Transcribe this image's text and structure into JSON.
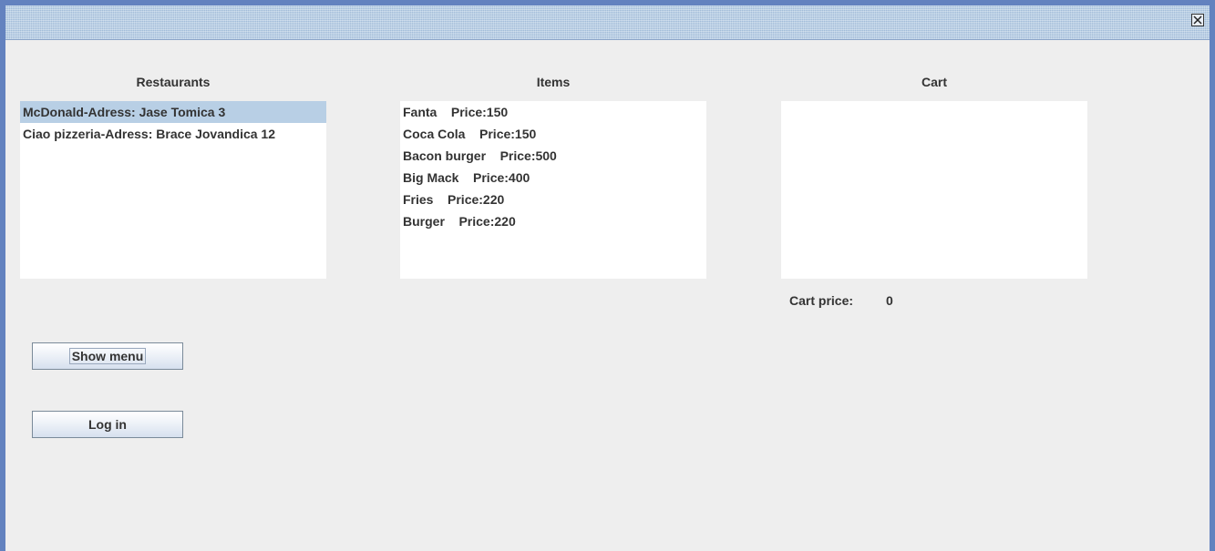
{
  "window": {
    "close_icon": "close-icon"
  },
  "restaurants": {
    "label": "Restaurants",
    "items": [
      {
        "text": "McDonald-Adress: Jase Tomica 3",
        "selected": true
      },
      {
        "text": "Ciao pizzeria-Adress: Brace Jovandica 12",
        "selected": false
      }
    ]
  },
  "items": {
    "label": "Items",
    "rows": [
      "Fanta    Price:150",
      "Coca Cola    Price:150",
      "Bacon burger    Price:500",
      "Big Mack    Price:400",
      "Fries    Price:220",
      "Burger    Price:220"
    ]
  },
  "cart": {
    "label": "Cart",
    "rows": [],
    "price_label": "Cart price:",
    "price_value": "0"
  },
  "buttons": {
    "show_menu": "Show menu",
    "log_in": "Log in"
  },
  "colors": {
    "frame": "#6382bf",
    "selection": "#b8cfe5",
    "background": "#eeeeee"
  }
}
